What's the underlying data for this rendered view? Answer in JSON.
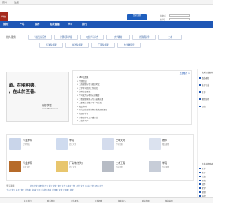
{
  "topbar": {
    "left": "高考",
    "right": "注册"
  },
  "logo": {
    "text": "学校"
  },
  "login": {
    "button": "登录注册",
    "user_label": "用户名",
    "pass_label": "密 码"
  },
  "nav": [
    "首页",
    "广场",
    "推荐",
    "电商直播",
    "学习",
    "排行"
  ],
  "cats": [
    {
      "head": "线人服务",
      "items": [
        "专业知识写作",
        "计算机科学报",
        "电信学习平台",
        "大学教材",
        "计算机科学",
        "土木"
      ]
    },
    {
      "head": "",
      "items": [
        "石油专业课",
        "政法专业课",
        "厂区专业课",
        "大学教研室"
      ]
    }
  ],
  "banner": {
    "l1": "道，在明明德，",
    "l2": "，在止於至善。",
    "stamp": "行楼学堂",
    "url": "www.360doc.com"
  },
  "news": {
    "more": "更多推荐 >",
    "items": [
      "• ABC结算课",
      "• 学理论证",
      "• 工商管理与专业知识考试",
      "• 大学学习院的工作研究",
      "• 资料检查课堂",
      "• 学习能力与考研心理教育",
      "• 工程管理体系与专业技术应用",
      "• 土建课计划推介与学习方法",
      "• 精品学科",
      "• 现代工程自然与标准化管理与课程",
      "• 培训与学习",
      "• 事物程序与工作重要性",
      "• 工程学习 >"
    ]
  },
  "right": {
    "title": "优秀专业推荐",
    "items": [
      "精选课程",
      "电子专业",
      "文字",
      "课程推荐",
      "工程"
    ],
    "title2": "专业推荐列表",
    "items2": [
      "文学",
      "电子",
      "计算",
      "机电",
      "软件",
      "数学",
      "管理",
      "法律",
      "建筑"
    ]
  },
  "schools": [
    {
      "name": "专业学院",
      "sub": "汉学院校",
      "color": "#c9d5ea"
    },
    {
      "name": "学院",
      "sub": "北京大学",
      "color": "#cfdbef"
    },
    {
      "name": "文明天地",
      "sub": "学习资源",
      "color": "#d4dced"
    },
    {
      "name": "推荐",
      "sub": "精品课程",
      "color": "#dbe2ef"
    },
    {
      "name": "专业学院",
      "sub": "北京大学",
      "color": "#b66b2a"
    },
    {
      "name": "厂房学(长大)",
      "sub": "北京大学",
      "color": "#e8c66e"
    },
    {
      "name": "土木工程",
      "sub": "专业课程",
      "color": "#b7bcc5"
    },
    {
      "name": "学院",
      "sub": "专业课程",
      "color": "#c7cdd8"
    }
  ],
  "bottom": {
    "head": "学习资源",
    "top": "北京大学 | 清华大学 | 浙江大学 | 复旦大学 | 南京大学 | 武汉大学 | 中山大学 | 四川大学",
    "mid": "土木工程 | 电子工程 | 计算机 | 机械工程 | 法律 | 金融 | 管理 | 文学 | 物理 | 化学"
  },
  "footer": [
    "关于我们",
    "联系我们",
    "广告服务",
    "人才招聘",
    "帮助中心",
    "网站地图",
    "版权声明"
  ]
}
